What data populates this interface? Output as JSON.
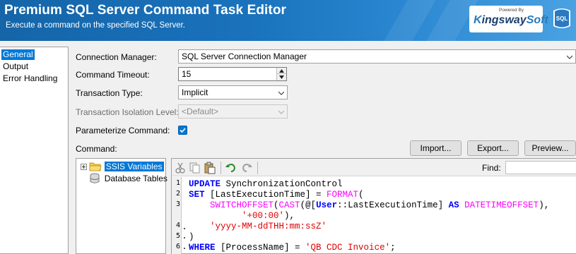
{
  "header": {
    "title": "Premium SQL Server Command Task Editor",
    "subtitle": "Execute a command on the specified SQL Server.",
    "logo_small": "Powered By",
    "logo_brand_prefix": "K",
    "logo_brand_mid": "ingsway",
    "logo_brand_suffix": "Soft",
    "product_icon_text": "SQL"
  },
  "nav": {
    "items": [
      {
        "label": "General",
        "selected": true
      },
      {
        "label": "Output",
        "selected": false
      },
      {
        "label": "Error Handling",
        "selected": false
      }
    ]
  },
  "form": {
    "connection_manager": {
      "label": "Connection Manager:",
      "value": "SQL Server Connection Manager"
    },
    "command_timeout": {
      "label": "Command Timeout:",
      "value": "15"
    },
    "transaction_type": {
      "label": "Transaction Type:",
      "value": "Implicit"
    },
    "isolation_level": {
      "label": "Transaction Isolation Level:",
      "value": "<Default>"
    },
    "parameterize": {
      "label": "Parameterize Command:",
      "checked": true
    },
    "command": {
      "label": "Command:"
    }
  },
  "buttons": {
    "import": "Import...",
    "export": "Export...",
    "preview": "Preview..."
  },
  "tree": {
    "items": [
      {
        "label": "SSIS Variables",
        "selected": true,
        "expandable": true
      },
      {
        "label": "Database Tables",
        "selected": false,
        "expandable": false
      }
    ]
  },
  "editor": {
    "find_label": "Find:",
    "find_value": "",
    "line_numbers": [
      "1",
      "2",
      "3",
      "",
      "4",
      "5",
      "6"
    ],
    "code": {
      "l1_kw": "UPDATE",
      "l1_rest": " SynchronizationControl",
      "l2_kw": "SET",
      "l2_mid": " [LastExecutionTime] = ",
      "l2_fn": "FORMAT",
      "l2_end": "(",
      "l3_fn1": "SWITCHOFFSET",
      "l3_p1": "(",
      "l3_fn2": "CAST",
      "l3_p2": "(@[",
      "l3_user": "User",
      "l3_var": "::LastExecutionTime] ",
      "l3_as": "AS",
      "l3_type": "DATETIMEOFFSET",
      "l3_end": "),",
      "l3b_str": "'+00:00'",
      "l3b_end": "),",
      "l4_str": "'yyyy-MM-ddTHH:mm:ssZ'",
      "l5": ")",
      "l6_kw": "WHERE",
      "l6_mid": " [ProcessName] = ",
      "l6_str": "'QB CDC Invoice'",
      "l6_end": ";"
    }
  },
  "colors": {
    "header_blue": "#1a73bd",
    "selection": "#0078d7",
    "keyword": "#0000ff",
    "function": "#ff00ff",
    "string": "#e00000"
  }
}
